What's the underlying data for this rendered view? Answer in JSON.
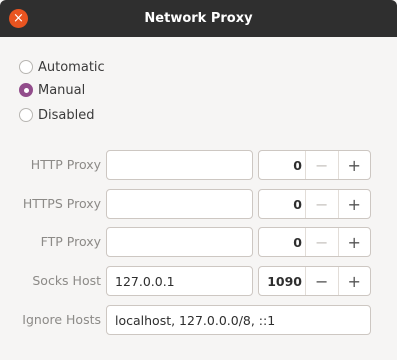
{
  "window": {
    "title": "Network Proxy",
    "close_glyph": "×"
  },
  "modes": [
    {
      "label": "Automatic",
      "checked": false
    },
    {
      "label": "Manual",
      "checked": true
    },
    {
      "label": "Disabled",
      "checked": false
    }
  ],
  "proxies": [
    {
      "label": "HTTP Proxy",
      "host": "",
      "port": "0",
      "minus": "−",
      "plus": "+"
    },
    {
      "label": "HTTPS Proxy",
      "host": "",
      "port": "0",
      "minus": "−",
      "plus": "+"
    },
    {
      "label": "FTP Proxy",
      "host": "",
      "port": "0",
      "minus": "−",
      "plus": "+"
    },
    {
      "label": "Socks Host",
      "host": "127.0.0.1",
      "port": "1090",
      "minus": "−",
      "plus": "+"
    }
  ],
  "ignore_hosts": {
    "label": "Ignore Hosts",
    "value": "localhost, 127.0.0.0/8, ::1"
  },
  "colors": {
    "titlebar": "#2f2f2f",
    "close": "#e95420",
    "accent": "#924d8b"
  }
}
